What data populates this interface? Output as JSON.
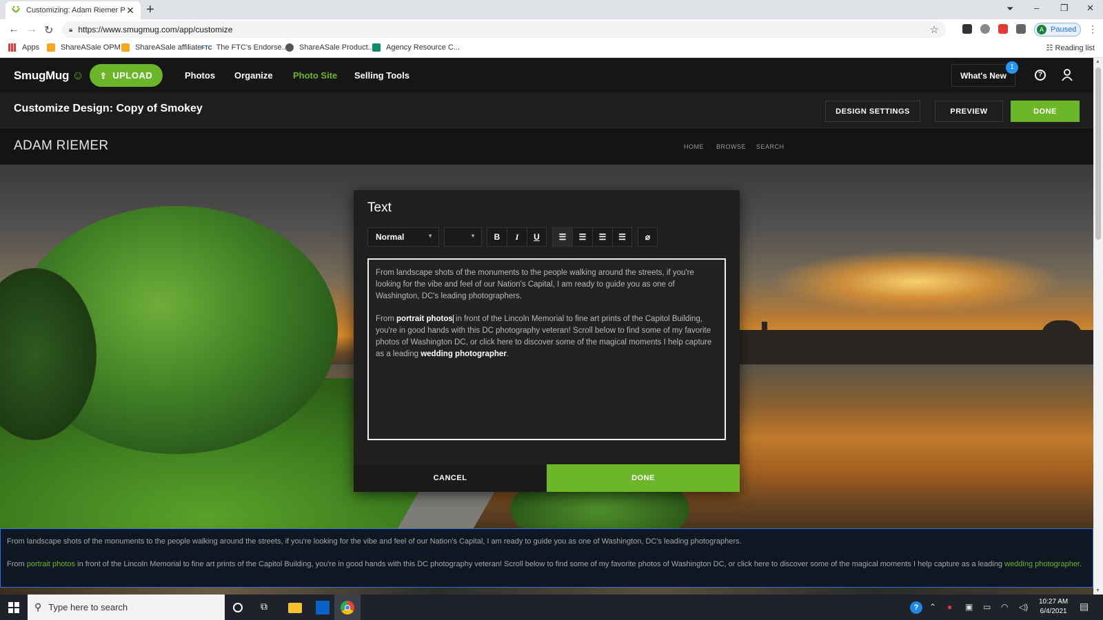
{
  "browser": {
    "tab_title": "Customizing: Adam Riemer Phot",
    "url": "https://www.smugmug.com/app/customize",
    "profile_label": "Paused",
    "profile_initial": "A",
    "bookmarks": [
      "Apps",
      "ShareASale OPM",
      "ShareASale affiliate",
      "The FTC's Endorse...",
      "ShareASale Product...",
      "Agency Resource C..."
    ],
    "ftc_icon_text": "FTC",
    "reading_list": "Reading list"
  },
  "header": {
    "logo": "SmugMug",
    "upload_label": "UPLOAD",
    "nav": [
      "Photos",
      "Organize",
      "Photo Site",
      "Selling Tools"
    ],
    "active_nav": "Photo Site",
    "whats_new": "What's New",
    "badge_count": "1"
  },
  "customize": {
    "title": "Customize Design: Copy of Smokey",
    "design_settings": "DESIGN SETTINGS",
    "preview": "PREVIEW",
    "done": "DONE"
  },
  "site": {
    "name": "ADAM RIEMER",
    "nav": [
      "HOME",
      "BROWSE",
      "SEARCH"
    ]
  },
  "dialog": {
    "title": "Text",
    "format_value": "Normal",
    "toolbar": {
      "bold": "B",
      "italic": "I",
      "underline": "U"
    },
    "paragraph1": "From landscape shots of the monuments to the people walking around the streets, if you're looking for the vibe and feel of our Nation's Capital, I am ready to guide you as one of Washington, DC's leading photographers.",
    "p2_prefix": "From ",
    "p2_link1": "portrait photos",
    "p2_middle": " in front of the Lincoln Memorial to fine art prints of the Capitol Building, you're in good hands with this DC photography veteran!  Scroll below to find some of my favorite photos of Washington DC, or click here to discover some of the magical moments I help capture as a leading ",
    "p2_link2": "wedding photographer",
    "p2_suffix": ".",
    "cancel": "CANCEL",
    "done": "DONE"
  },
  "taskbar": {
    "search_placeholder": "Type here to search",
    "time": "10:27 AM",
    "date": "6/4/2021"
  },
  "colors": {
    "accent_green": "#6cb629",
    "selection_blue": "#2f6fd8",
    "badge_blue": "#2196f3"
  }
}
